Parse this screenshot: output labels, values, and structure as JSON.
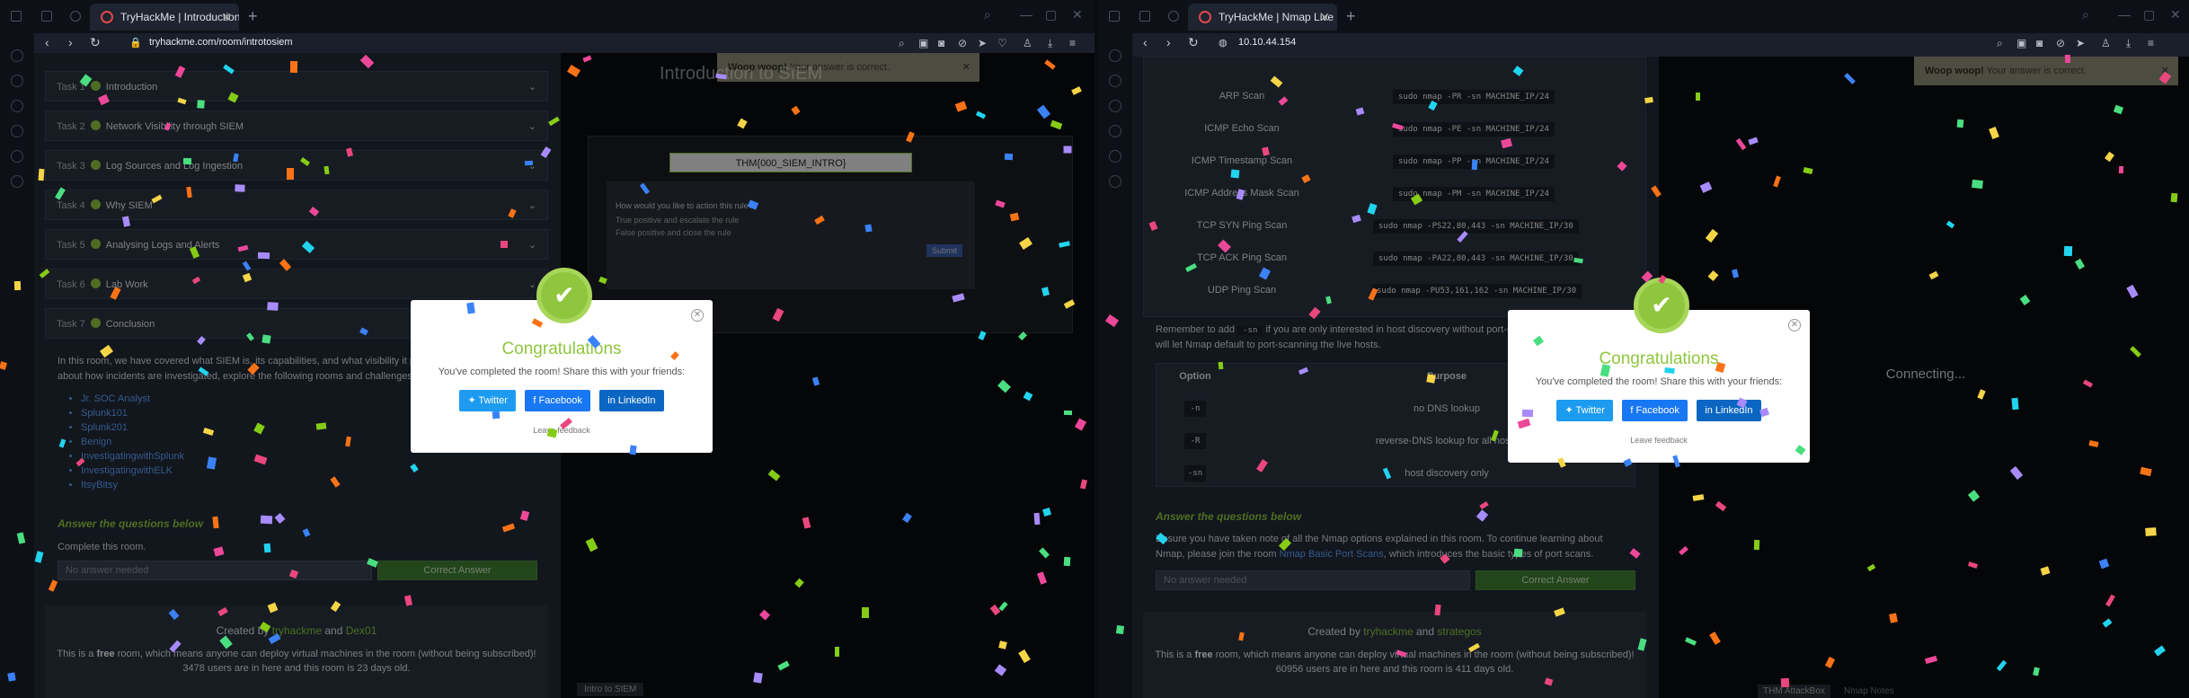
{
  "window1": {
    "tab_title": "TryHackMe | Introduction to SIEM",
    "url": "tryhackme.com/room/introtosiem",
    "tasks": [
      {
        "num": "Task 1",
        "title": "Introduction"
      },
      {
        "num": "Task 2",
        "title": "Network Visibility through SIEM"
      },
      {
        "num": "Task 3",
        "title": "Log Sources and Log Ingestion"
      },
      {
        "num": "Task 4",
        "title": "Why SIEM"
      },
      {
        "num": "Task 5",
        "title": "Analysing Logs and Alerts"
      },
      {
        "num": "Task 6",
        "title": "Lab Work"
      },
      {
        "num": "Task 7",
        "title": "Conclusion"
      }
    ],
    "conclusion_text_1": "In this room, we have covered what SIEM is, its capabilities, and what visibility it provides. To learn more",
    "conclusion_text_2": "about how incidents are investigated, explore the following rooms and challenges.",
    "links": [
      "Jr. SOC Analyst",
      "Splunk101",
      "Splunk201",
      "Benign",
      "InvestigatingwithSplunk",
      "InvestigatingwithELK",
      "ItsyBitsy"
    ],
    "answer_heading": "Answer the questions below",
    "question": "Complete this room.",
    "answer_placeholder": "No answer needed",
    "answer_button": "Correct Answer",
    "created_by": "Created by",
    "author1": "tryhackme",
    "and": "and",
    "author2": "Dex01",
    "footer_line1_a": "This is a",
    "footer_free": "free",
    "footer_line1_b": "room, which means anyone can deploy virtual machines in the room (without being subscribed)!",
    "footer_line2": "3478 users are in here and this room is 23 days old.",
    "vm_heading": "Introduction to SIEM",
    "vm_flag": "THM{000_SIEM_INTRO}",
    "vm_question": "How would you like to action this rule?",
    "vm_option1": "True positive and escalate the rule",
    "vm_option2": "False positive and close the rule",
    "vm_submit": "Submit",
    "vm_bottom_label": "Intro to SIEM",
    "toast_bold": "Woop woop!",
    "toast_text": "Your answer is correct."
  },
  "window2": {
    "tab_title": "TryHackMe | Nmap Live Host Discovery",
    "url": "10.10.44.154",
    "scans": [
      {
        "label": "ARP Scan",
        "cmd": "sudo nmap -PR -sn MACHINE_IP/24"
      },
      {
        "label": "ICMP Echo Scan",
        "cmd": "sudo nmap -PE -sn MACHINE_IP/24"
      },
      {
        "label": "ICMP Timestamp Scan",
        "cmd": "sudo nmap -PP -sn MACHINE_IP/24"
      },
      {
        "label": "ICMP Address Mask Scan",
        "cmd": "sudo nmap -PM -sn MACHINE_IP/24"
      },
      {
        "label": "TCP SYN Ping Scan",
        "cmd": "sudo nmap -PS22,80,443 -sn MACHINE_IP/30"
      },
      {
        "label": "TCP ACK Ping Scan",
        "cmd": "sudo nmap -PA22,80,443 -sn MACHINE_IP/30"
      },
      {
        "label": "UDP Ping Scan",
        "cmd": "sudo nmap -PU53,161,162 -sn MACHINE_IP/30"
      }
    ],
    "remember_a": "Remember to add",
    "remember_code": "-sn",
    "remember_b": "if you are only interested in host discovery without port-scanning. Omitting -sn",
    "remember_c": "will let Nmap default to port-scanning the live hosts.",
    "table_head_option": "Option",
    "table_head_purpose": "Purpose",
    "options": [
      {
        "code": "-n",
        "purpose": "no DNS lookup"
      },
      {
        "code": "-R",
        "purpose": "reverse-DNS lookup for all hosts"
      },
      {
        "code": "-sn",
        "purpose": "host discovery only"
      }
    ],
    "answer_heading": "Answer the questions below",
    "ensure_a": "Ensure you have taken note of all the Nmap options explained in this room. To continue learning about",
    "ensure_b": "Nmap, please join the room",
    "ensure_link": "Nmap Basic Port Scans",
    "ensure_c": ", which introduces the basic types of port scans.",
    "answer_placeholder": "No answer needed",
    "answer_button": "Correct Answer",
    "created_by": "Created by",
    "author1": "tryhackme",
    "and": "and",
    "author2": "strategos",
    "footer_line1_a": "This is a",
    "footer_free": "free",
    "footer_line1_b": "room, which means anyone can deploy virtual machines in the room (without being subscribed)!",
    "footer_line2": "60956 users are in here and this room is 411 days old.",
    "vm_status": "Connecting...",
    "vm_bottom_label": "THM AttackBox",
    "vm_bottom_label2": "Nmap Notes",
    "toast_bold": "Woop woop!",
    "toast_text": "Your answer is correct."
  },
  "modal": {
    "title": "Congratulations",
    "subtitle": "You've completed the room! Share this with your friends:",
    "twitter": "Twitter",
    "facebook": "Facebook",
    "linkedin": "LinkedIn",
    "feedback": "Leave feedback"
  },
  "colors": {
    "accent_green": "#8fc63e",
    "link_blue": "#5ea5ff",
    "twitter": "#1d9bf0",
    "facebook": "#1877f2",
    "linkedin": "#0a66c2"
  }
}
